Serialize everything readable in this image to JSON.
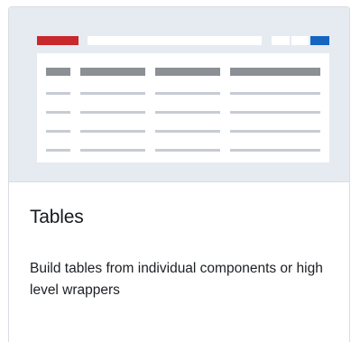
{
  "card": {
    "title": "Tables",
    "description": "Build tables from individual components or high level wrappers",
    "preview_icon": "table-illustration-icon"
  },
  "colors": {
    "accent_red": "#c9282d",
    "accent_blue": "#1565c0",
    "preview_bg": "#e6ebf1",
    "header_cell": "#8c8f94",
    "row_cell": "#c7ccd3"
  }
}
